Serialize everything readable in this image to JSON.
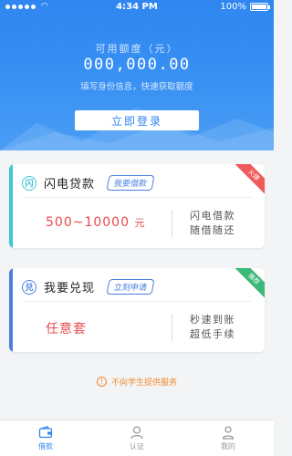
{
  "status_bar": {
    "time": "4:34 PM",
    "battery": "100%"
  },
  "hero": {
    "credit_label": "可用额度（元）",
    "credit_amount": "000,000.00",
    "hint": "填写身份信息，快速获取额度",
    "login_button": "立即登录"
  },
  "cards": [
    {
      "icon_glyph": "闪",
      "title": "闪电贷款",
      "tag": "我要借款",
      "value": "500~10000",
      "unit": "元",
      "desc_line1": "闪电借款",
      "desc_line2": "随借随还",
      "ribbon": "火爆",
      "accent": "#3dc6d8",
      "ribbon_color": "#f05a5a"
    },
    {
      "icon_glyph": "兑",
      "title": "我要兑现",
      "tag": "立刻申请",
      "value": "任意套",
      "unit": "",
      "desc_line1": "秒速到账",
      "desc_line2": "超低手续",
      "ribbon": "推荐",
      "accent": "#4a7fe0",
      "ribbon_color": "#3cb878"
    }
  ],
  "notice": {
    "icon": "!",
    "text": "不向学生提供服务"
  },
  "tabbar": {
    "items": [
      {
        "label": "借款",
        "icon": "wallet-icon",
        "active": true
      },
      {
        "label": "认证",
        "icon": "person-icon",
        "active": false
      },
      {
        "label": "我的",
        "icon": "profile-icon",
        "active": false
      }
    ]
  },
  "colors": {
    "primary": "#2f86f0",
    "danger": "#e9494d",
    "warning": "#f08a2e"
  }
}
